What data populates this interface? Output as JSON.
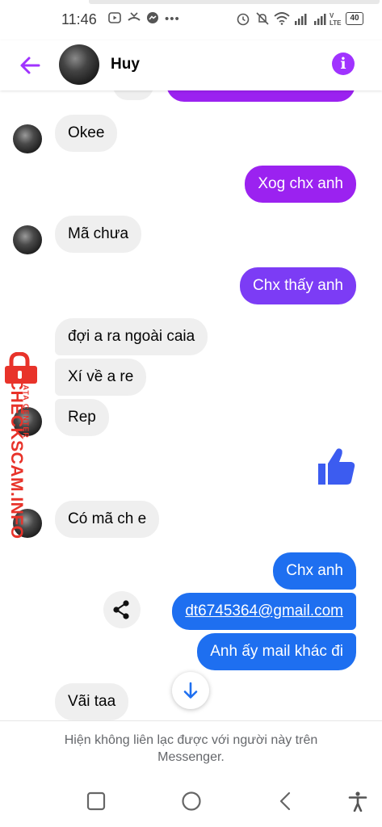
{
  "status_bar": {
    "time": "11:46",
    "battery": "40",
    "icons": [
      "youtube-icon",
      "missed-call-icon",
      "messenger-icon",
      "more-dots-icon",
      "alarm-icon",
      "mute-icon",
      "wifi-icon",
      "signal-icon",
      "signal-icon",
      "volte-icon",
      "battery-icon"
    ]
  },
  "header": {
    "name": "Huy",
    "info_icon": "i"
  },
  "messages": [
    {
      "side": "in",
      "text": "Okee"
    },
    {
      "side": "out",
      "text": "Xog chx anh"
    },
    {
      "side": "in",
      "text": "Mã chưa"
    },
    {
      "side": "out",
      "text": "Chx thấy anh"
    },
    {
      "side": "in",
      "text": "đợi a ra ngoài caia"
    },
    {
      "side": "in",
      "text": "Xí về a re"
    },
    {
      "side": "in",
      "text": "Rep"
    },
    {
      "side": "out",
      "type": "like-sticker"
    },
    {
      "side": "in",
      "text": "Có mã ch e"
    },
    {
      "side": "out",
      "text": "Chx anh"
    },
    {
      "side": "out",
      "text": "dt6745364@gmail.com"
    },
    {
      "side": "out",
      "text": "Anh ấy mail khác đi"
    },
    {
      "side": "in",
      "text": "Vãi taa"
    }
  ],
  "watermark": {
    "brand": "CHECKSCAM.INFO",
    "tagline": "DATA CENTER"
  },
  "footer": {
    "notice": "Hiện không liên lạc được với người này trên Messenger."
  },
  "colors": {
    "accent_purple": "#a033ff",
    "bubble_purple": "#9b22f0",
    "bubble_violet": "#7c3cf5",
    "bubble_blue": "#1e6ff0",
    "incoming_gray": "#efefef",
    "watermark_red": "#e8332a"
  }
}
